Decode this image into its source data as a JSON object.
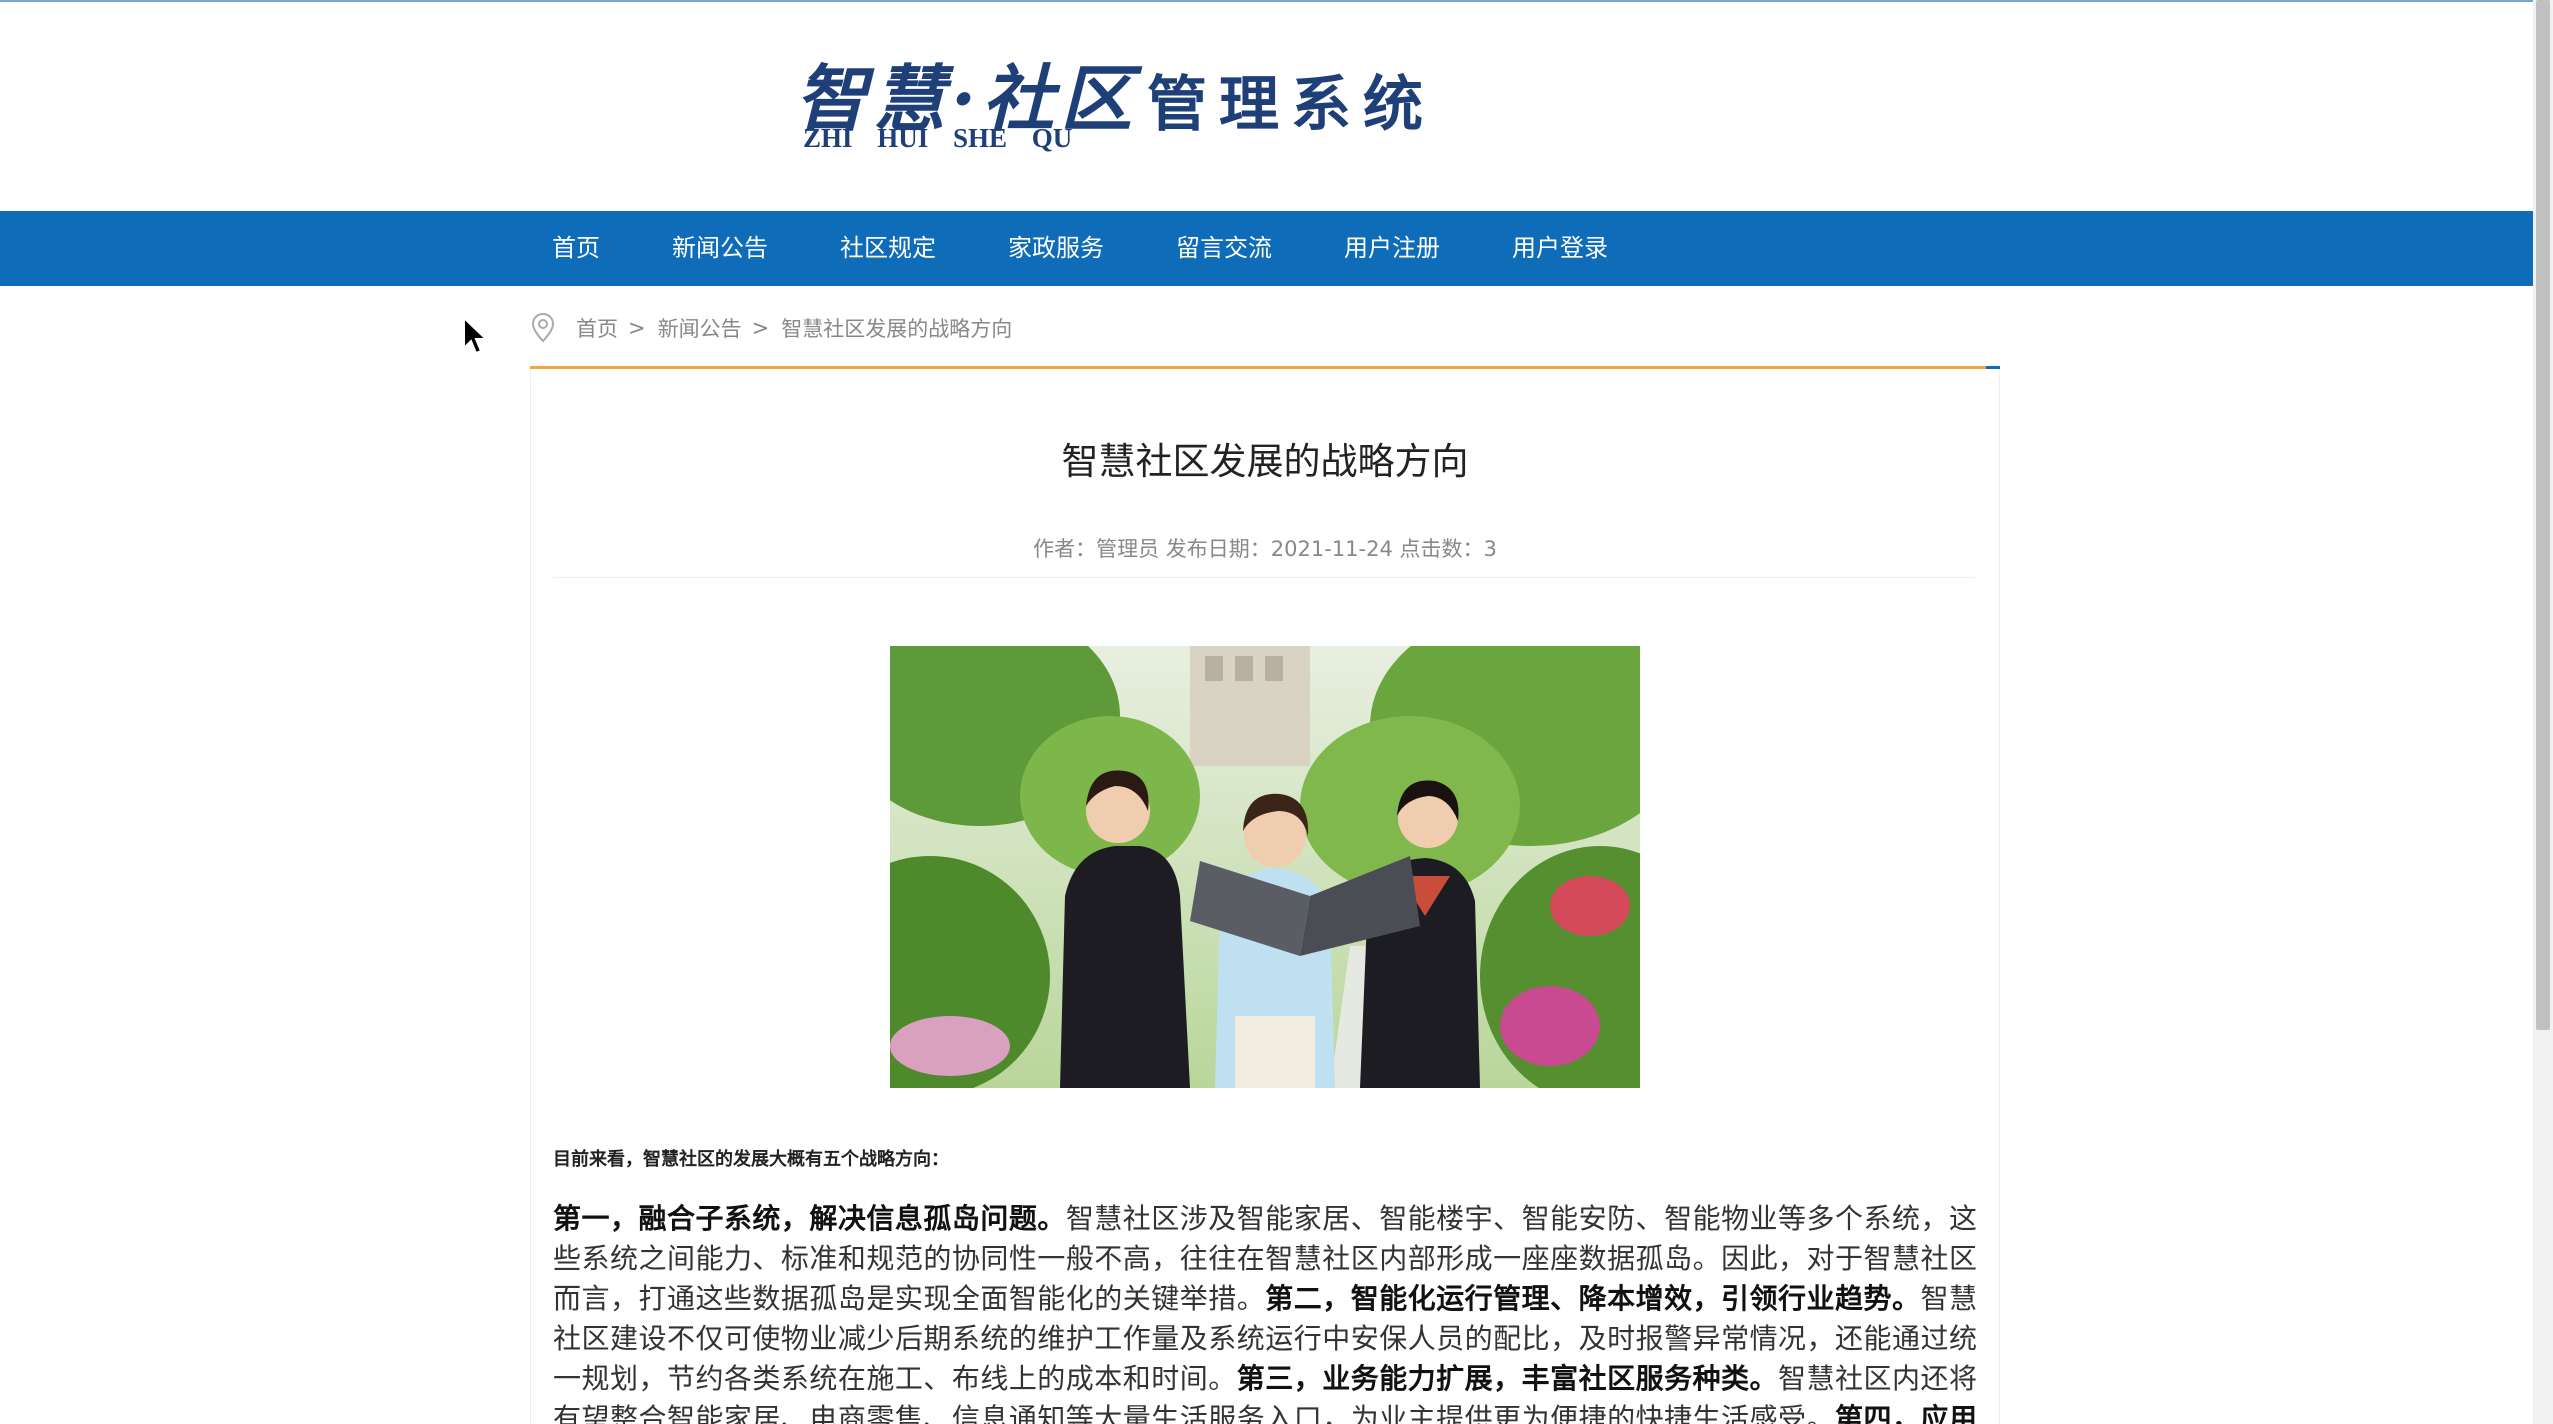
{
  "header": {
    "logo_hanzi": "智慧·社区",
    "logo_pinyin": "ZHI HUI SHE QU",
    "logo_system": "管理系统"
  },
  "nav": {
    "items": [
      {
        "label": "首页"
      },
      {
        "label": "新闻公告"
      },
      {
        "label": "社区规定"
      },
      {
        "label": "家政服务"
      },
      {
        "label": "留言交流"
      },
      {
        "label": "用户注册"
      },
      {
        "label": "用户登录"
      }
    ]
  },
  "breadcrumb": {
    "home": "首页",
    "separator": ">",
    "section": "新闻公告",
    "current": "智慧社区发展的战略方向"
  },
  "article": {
    "title": "智慧社区发展的战略方向",
    "meta": "作者：管理员 发布日期：2021-11-24 点击数：3",
    "intro": "目前来看，智慧社区的发展大概有五个战略方向：",
    "p1_bold": "第一，融合子系统，解决信息孤岛问题。",
    "p1_text": "智慧社区涉及智能家居、智能楼宇、智能安防、智能物业等多个系统，这些系统之间能力、标准和规范的协同性一般不高，往往在智慧社区内部形成一座座数据孤岛。因此，对于智慧社区而言，打通这些数据孤岛是实现全面智能化的关键举措。",
    "p2_bold": "第二，智能化运行管理、降本增效，引领行业趋势。",
    "p2_text": "智慧社区建设不仅可使物业减少后期系统的维护工作量及系统运行中安保人员的配比，及时报警异常情况，还能通过统一规划，节约各类系统在施工、布线上的成本和时间。",
    "p3_bold": "第三，业务能力扩展，丰富社区服务种类。",
    "p3_text": "智慧社区内还将有望整合智能家居、电商零售、信息通知等大量生活服务入口，为业主提供更为便捷的快捷生活感受。",
    "p4_bold": "第四，应用智能化，使信息更为精准"
  },
  "colors": {
    "nav_bg": "#0f6cb8",
    "logo": "#1e3f78",
    "divider": "#f0a83c"
  }
}
